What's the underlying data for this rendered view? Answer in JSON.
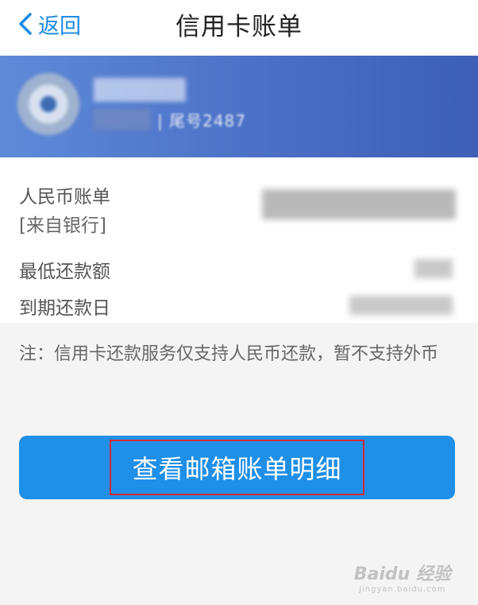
{
  "nav": {
    "back_label": "返回",
    "title": "信用卡账单"
  },
  "card": {
    "tail_text": "| 尾号2487"
  },
  "info": {
    "rmb_label": "人民币账单",
    "source_label": "[来自银行]",
    "min_payment_label": "最低还款额",
    "due_date_label": "到期还款日"
  },
  "note": "注：信用卡还款服务仅支持人民币还款，暂不支持外币",
  "button": {
    "label": "查看邮箱账单明细"
  },
  "watermark": {
    "brand": "Baidu 经验",
    "url": "jingyan.baidu.com"
  },
  "colors": {
    "accent": "#1f8fe8",
    "card_blue": "#4b70c6",
    "highlight_red": "#d42a33"
  }
}
